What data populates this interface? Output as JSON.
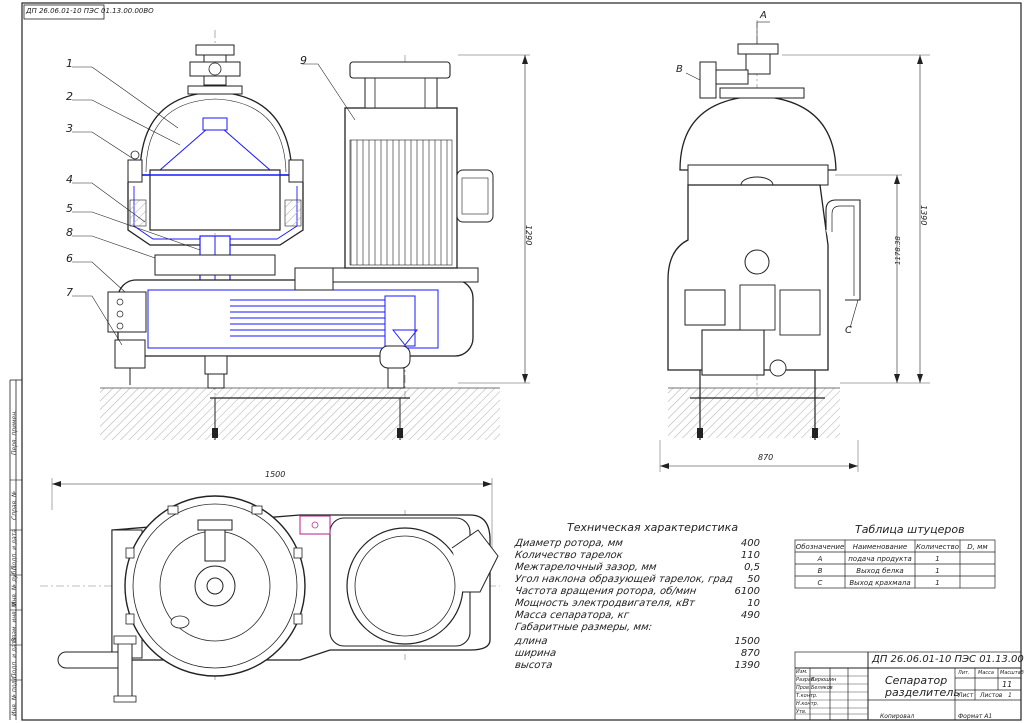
{
  "document_code_top": "ДП 26.06.01-10 ПЭС 01.13.00.00ВО",
  "callouts": [
    "1",
    "2",
    "3",
    "4",
    "5",
    "6",
    "7",
    "8",
    "9"
  ],
  "side_callouts": [
    "A",
    "B",
    "C"
  ],
  "dimensions": {
    "front_height": "1290",
    "right_height": "1390",
    "right_inner": "1178.38",
    "right_width": "870",
    "plan_width": "1500"
  },
  "specs": {
    "title": "Техническая характеристика",
    "rows": [
      {
        "name": "Диаметр ротора, мм",
        "value": "400"
      },
      {
        "name": "Количество тарелок",
        "value": "110"
      },
      {
        "name": "Межтарелочный зазор, мм",
        "value": "0,5"
      },
      {
        "name": "Угол наклона образующей тарелок, град",
        "value": "50"
      },
      {
        "name": "Частота вращения ротора, об/мин",
        "value": "6100"
      },
      {
        "name": "Мощность электродвигателя, кВт",
        "value": "10"
      },
      {
        "name": "Масса сепаратора, кг",
        "value": "490"
      },
      {
        "name": "Габаритные размеры, мм:",
        "value": ""
      },
      {
        "name": "длина",
        "value": "1500"
      },
      {
        "name": "ширина",
        "value": "870"
      },
      {
        "name": "высота",
        "value": "1390"
      }
    ]
  },
  "nozzles": {
    "title": "Таблица штуцеров",
    "headers": [
      "Обозначение",
      "Наименование",
      "Количество",
      "D, мм"
    ],
    "rows": [
      [
        "А",
        "подача продукта",
        "1",
        ""
      ],
      [
        "В",
        "Выход белка",
        "1",
        ""
      ],
      [
        "С",
        "Выход крахмала",
        "1",
        ""
      ]
    ]
  },
  "stamp": {
    "code": "ДП 26.06.01-10 ПЭС 01.13.00.00ВО",
    "name_line1": "Сепаратор",
    "name_line2": "разделитель",
    "sheet_count": "11",
    "sheet_label": "Лист",
    "sheets_label": "Листов",
    "sheets_total": "1",
    "lit_label": "Лит.",
    "mass_label": "Масса",
    "scale_label": "Масштаб",
    "copied": "Копировал",
    "format": "Формат   А1",
    "roles": [
      "Изм.",
      "Разраб.",
      "Пров.",
      "Т.контр.",
      "Н.контр.",
      "Утв."
    ],
    "names": [
      "",
      "Кирюшин",
      "Беляков",
      "",
      "",
      ""
    ]
  },
  "left_strip": [
    "Перв. примен.",
    "Справ. №",
    "Подп. и дата",
    "Инв. № дубл.",
    "Взам. инв. №",
    "Подп. и дата",
    "Инв. № подл."
  ],
  "colors": {
    "line": "#2a2a2a",
    "accent": "#1a1aff",
    "hatch": "#9a9a9a",
    "magenta": "#c03090"
  }
}
